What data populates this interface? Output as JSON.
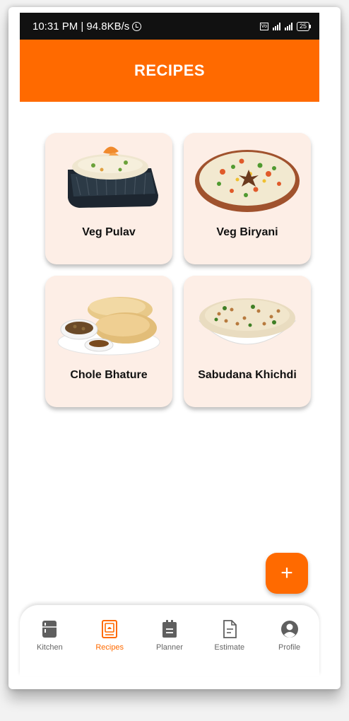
{
  "status_bar": {
    "time_speed": "10:31 PM | 94.8KB/s",
    "battery": "25"
  },
  "appbar": {
    "title": "RECIPES"
  },
  "recipes": [
    {
      "name": "Veg Pulav"
    },
    {
      "name": "Veg Biryani"
    },
    {
      "name": "Chole Bhature"
    },
    {
      "name": "Sabudana Khichdi"
    }
  ],
  "fab": {
    "label": "+"
  },
  "bottom_nav": [
    {
      "label": "Kitchen",
      "icon": "fridge-icon",
      "active": false
    },
    {
      "label": "Recipes",
      "icon": "recipe-book-icon",
      "active": true
    },
    {
      "label": "Planner",
      "icon": "clipboard-icon",
      "active": false
    },
    {
      "label": "Estimate",
      "icon": "document-icon",
      "active": false
    },
    {
      "label": "Profile",
      "icon": "user-icon",
      "active": false
    }
  ],
  "colors": {
    "accent": "#ff6a00",
    "card_bg": "#fdeee6",
    "status_bg": "#111111"
  }
}
